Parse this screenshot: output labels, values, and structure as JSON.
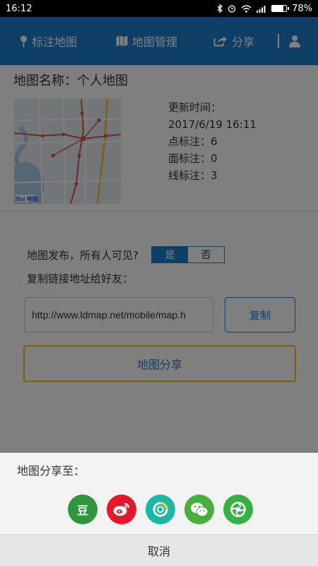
{
  "status": {
    "time": "16:12",
    "battery": "78%",
    "battery_level": 0.78
  },
  "nav": {
    "mark_label": "标注地图",
    "manage_label": "地图管理",
    "share_label": "分享"
  },
  "map": {
    "title": "地图名称：个人地图",
    "updated_label": "更新时间：",
    "updated_value": "2017/6/19 16:11",
    "points_label": "点标注：6",
    "areas_label": "面标注：0",
    "lines_label": "线标注：3",
    "thumb_brand": "Bai 地图"
  },
  "publish": {
    "question": "地图发布，所有人可见?",
    "yes": "是",
    "no": "否"
  },
  "copy": {
    "label": "复制链接地址给好友：",
    "url": "http://www.ldmap.net/mobile/map.h",
    "button": "复制"
  },
  "share_button": "地图分享",
  "sheet": {
    "title": "地图分享至：",
    "douban_glyph": "豆",
    "cancel": "取消",
    "targets": [
      {
        "name": "douban",
        "color": "#2e963d"
      },
      {
        "name": "weibo",
        "color": "#e6162d"
      },
      {
        "name": "qzone",
        "color": "#1bb8a7"
      },
      {
        "name": "wechat",
        "color": "#46b03a"
      },
      {
        "name": "moments",
        "color": "#33b340"
      }
    ]
  }
}
